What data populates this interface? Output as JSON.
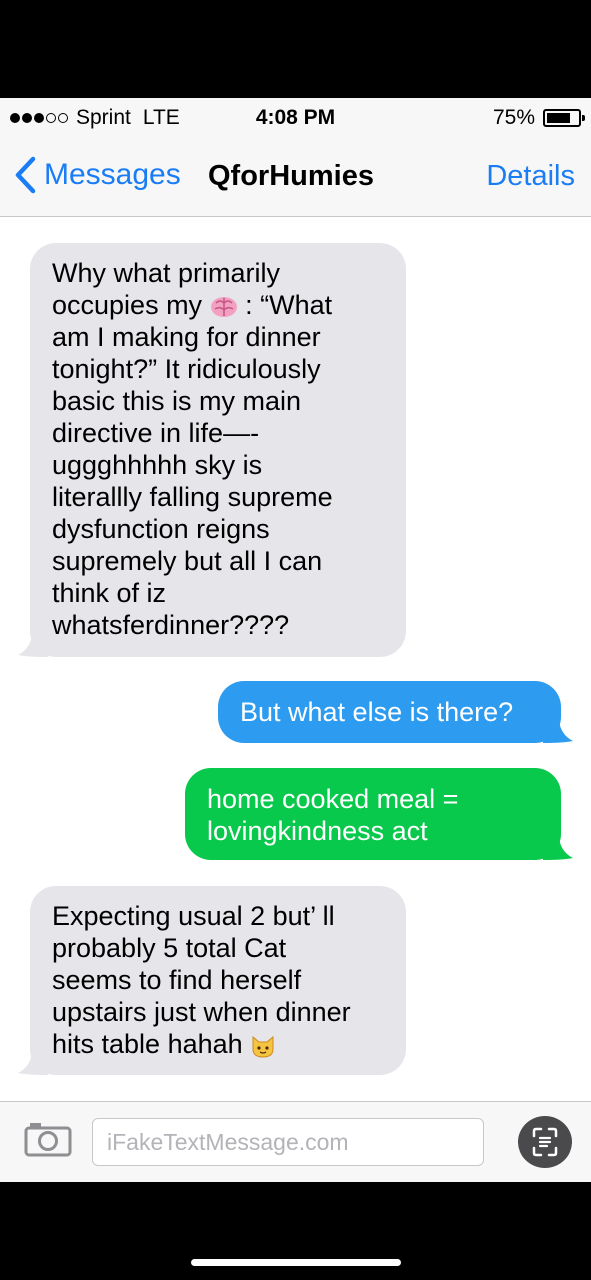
{
  "status_bar": {
    "carrier": "Sprint",
    "network": "LTE",
    "time": "4:08 PM",
    "battery": "75%",
    "battery_level": 0.75
  },
  "nav": {
    "back_label": "Messages",
    "title": "QforHumies",
    "details_label": "Details"
  },
  "messages": [
    {
      "direction": "incoming",
      "lines": [
        "Why what primarily",
        "occupies my",
        ": “What",
        "am I making for dinner",
        "tonight?” It ridiculously",
        "basic this is my main",
        "directive in life—-",
        "uggghhhhh sky is",
        "literallly falling supreme",
        "dysfunction reigns",
        "supremely but all I can",
        "think of iz",
        "whatsferdinner????"
      ],
      "emoji": "brain-icon"
    },
    {
      "direction": "outgoing",
      "service": "iMessage",
      "text": "But what else is there?"
    },
    {
      "direction": "outgoing",
      "service": "SMS",
      "lines": [
        "home cooked meal =",
        "lovingkindness act"
      ]
    },
    {
      "direction": "incoming",
      "lines": [
        "Expecting usual 2 but’ ll",
        "probably 5 total Cat",
        "seems to find herself",
        "upstairs just when dinner",
        "hits table hahah"
      ],
      "emoji": "cat-face-icon"
    }
  ],
  "input": {
    "placeholder": "iFakeTextMessage.com"
  },
  "colors": {
    "accent_blue": "#1a7df5",
    "incoming_bubble": "#e5e5ea",
    "imessage_bubble": "#2d9bf0",
    "sms_bubble": "#08c94b"
  }
}
